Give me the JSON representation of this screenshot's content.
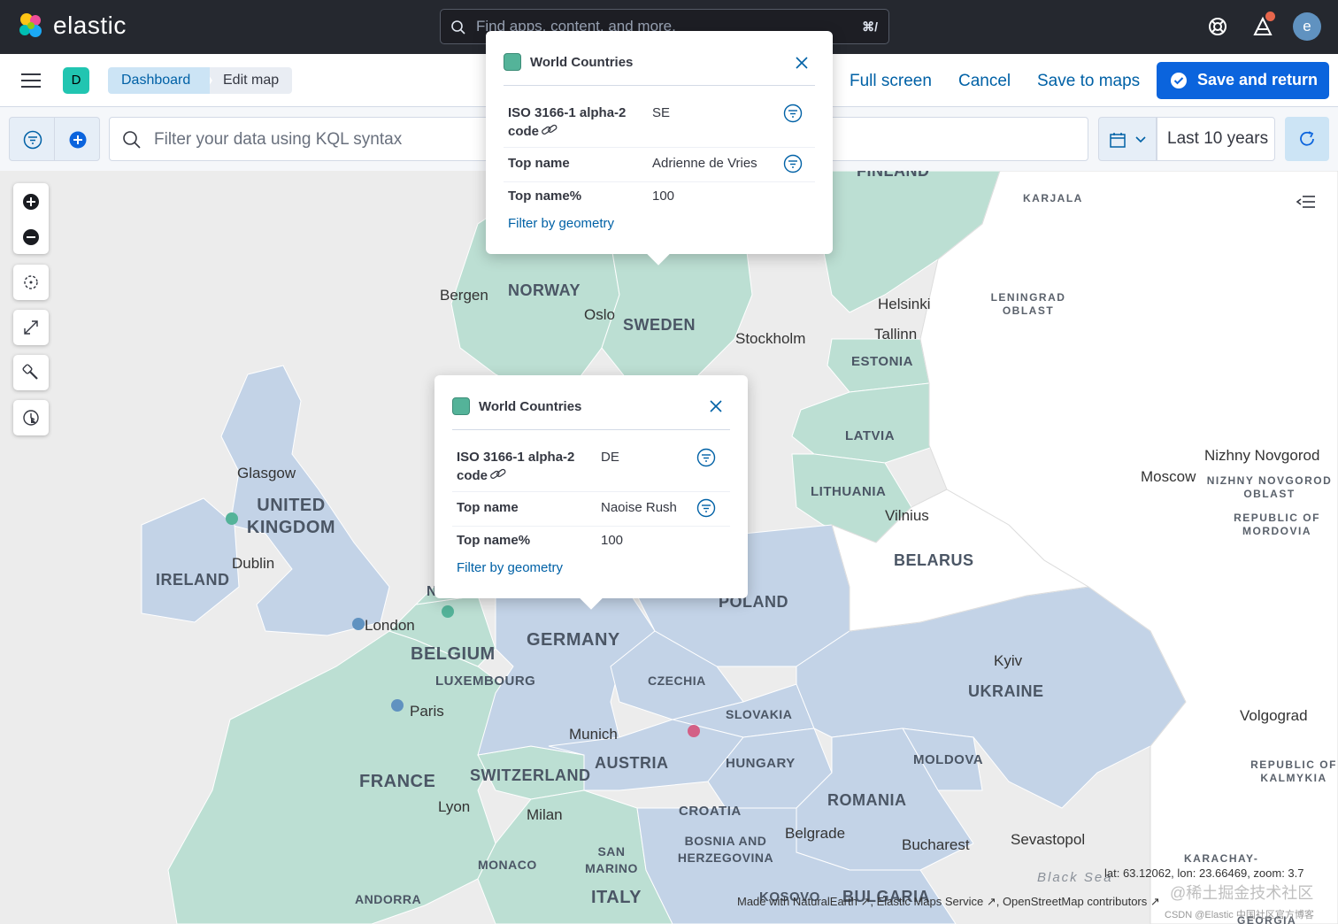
{
  "header": {
    "brand": "elastic",
    "search_placeholder": "Find apps, content, and more.",
    "search_shortcut": "⌘/",
    "avatar_letter": "e"
  },
  "subheader": {
    "space_letter": "D",
    "breadcrumbs": [
      "Dashboard",
      "Edit map"
    ],
    "actions": {
      "full_screen": "Full screen",
      "cancel": "Cancel",
      "save_to_maps": "Save to maps",
      "save_and_return": "Save and return"
    }
  },
  "query": {
    "placeholder": "Filter your data using KQL syntax",
    "time_range": "Last 10 years"
  },
  "popups": [
    {
      "layer": "World Countries",
      "rows": [
        {
          "key": "ISO 3166-1 alpha-2 code",
          "value": "SE"
        },
        {
          "key": "Top name",
          "value": "Adrienne de Vries"
        },
        {
          "key": "Top name%",
          "value": "100"
        }
      ],
      "action": "Filter by geometry"
    },
    {
      "layer": "World Countries",
      "rows": [
        {
          "key": "ISO 3166-1 alpha-2 code",
          "value": "DE"
        },
        {
          "key": "Top name",
          "value": "Naoise Rush"
        },
        {
          "key": "Top name%",
          "value": "100"
        }
      ],
      "action": "Filter by geometry"
    }
  ],
  "map": {
    "colors": {
      "green": "#bcdfd3",
      "blue": "#c3d3e7",
      "grey": "#eeeeee",
      "white": "#ffffff"
    },
    "cities": [
      "Bergen",
      "Oslo",
      "Stockholm",
      "Helsinki",
      "Tallinn",
      "Glasgow",
      "Dublin",
      "London",
      "Paris",
      "Munich",
      "Lyon",
      "Milan",
      "Vilnius",
      "Moscow",
      "Nizhny Novgorod",
      "Kyiv",
      "Volgograd",
      "Belgrade",
      "Bucharest",
      "Sevastopol"
    ],
    "countries": [
      "NORWAY",
      "SWEDEN",
      "FINLAND",
      "ESTONIA",
      "LATVIA",
      "LITHUANIA",
      "BELARUS",
      "POLAND",
      "GERMANY",
      "BELGIUM",
      "LUXEMBOURG",
      "CZECHIA",
      "SLOVAKIA",
      "AUSTRIA",
      "HUNGARY",
      "MOLDOVA",
      "UKRAINE",
      "ROMANIA",
      "CROATIA",
      "BOSNIA AND HERZEGOVINA",
      "KOSOVO",
      "BULGARIA",
      "ITALY",
      "SAN MARINO",
      "MONACO",
      "ANDORRA",
      "SWITZERLAND",
      "FRANCE",
      "UNITED KINGDOM",
      "IRELAND",
      "N"
    ],
    "regions": [
      "KARJALA",
      "LENINGRAD OBLAST",
      "NIZHNY NOVGOROD OBLAST",
      "REPUBLIC OF MORDOVIA",
      "REPUBLIC OF KALMYKIA",
      "KARACHAY-",
      "GEORGIA"
    ],
    "sea_label": "Black Sea",
    "coords_text": "lat: 63.12062, lon: 23.66469, zoom: 3.7",
    "attribution": "Made with NaturalEarth ↗, Elastic Maps Service ↗, OpenStreetMap contributors ↗",
    "watermark": "CSDN @Elastic 中国社区官方博客",
    "watermark2": "@稀土掘金技术社区"
  }
}
